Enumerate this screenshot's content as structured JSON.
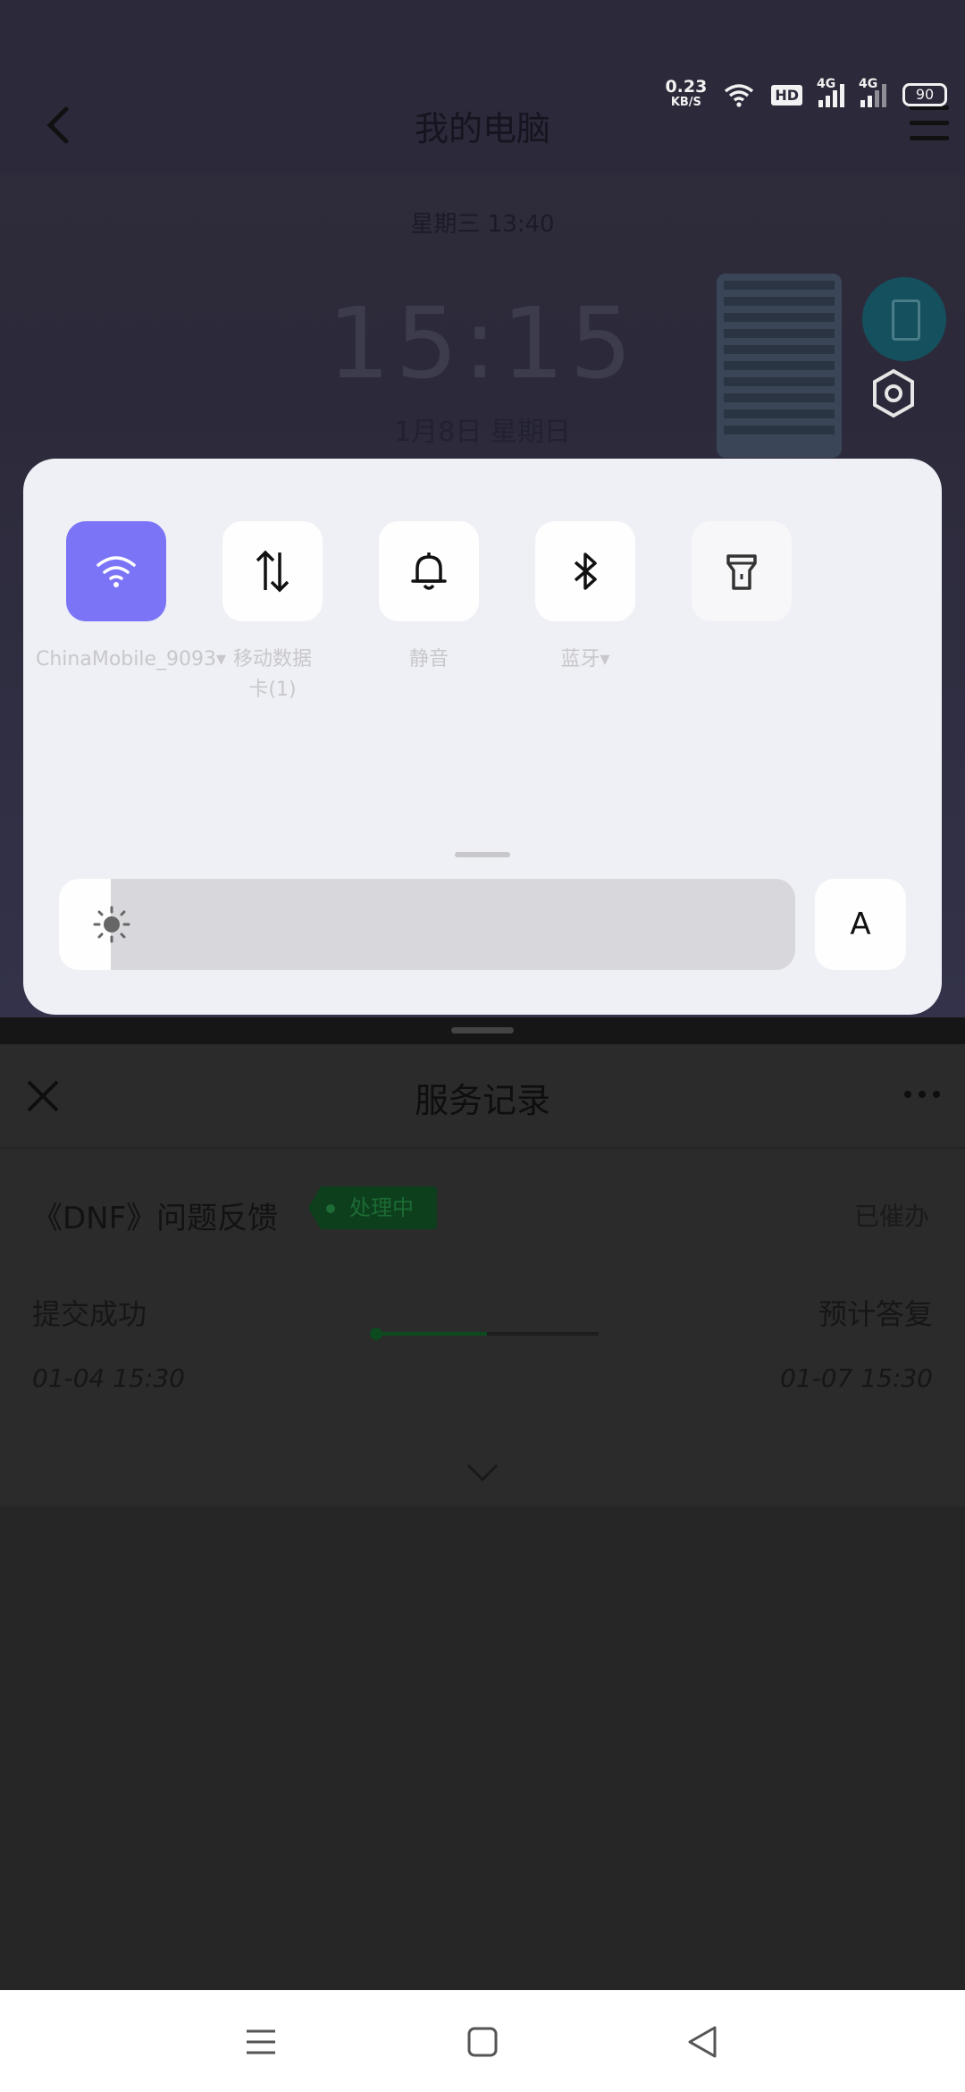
{
  "top_app": {
    "title": "我的电脑",
    "widget": {
      "date_line": "星期三 13:40",
      "time": "15:15",
      "day_line": "1月8日 星期日"
    }
  },
  "status_bar": {
    "speed_value": "0.23",
    "speed_unit": "KB/S",
    "hd": "HD",
    "net1": "4G",
    "net2": "4G",
    "battery": "90"
  },
  "quick_settings": {
    "tiles": [
      {
        "icon": "wifi-icon",
        "label": "ChinaMobile_9093▾",
        "active": true
      },
      {
        "icon": "mobile-data-icon",
        "label": "移动数据\n卡(1)",
        "active": false
      },
      {
        "icon": "bell-icon",
        "label": "静音",
        "active": false
      },
      {
        "icon": "bluetooth-icon",
        "label": "蓝牙▾",
        "active": false
      },
      {
        "icon": "flashlight-icon",
        "label": "",
        "active": false
      }
    ],
    "brightness_level": 0.07,
    "auto_label": "A",
    "accent_color": "#7b74f7"
  },
  "service": {
    "title": "服务记录",
    "issue_title": "《DNF》问题反馈",
    "status_tag": "处理中",
    "urge_label": "已催办",
    "submit_label": "提交成功",
    "submit_time": "01-04 15:30",
    "eta_label": "预计答复",
    "eta_time": "01-07 15:30",
    "progress": 0.5
  }
}
